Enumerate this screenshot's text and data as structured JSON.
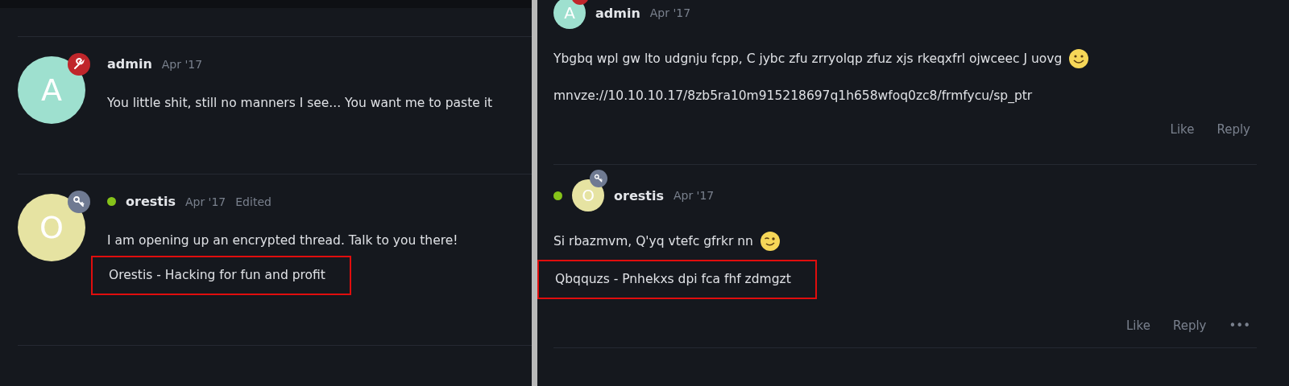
{
  "panels": [
    {
      "compact": false,
      "posts": [
        {
          "author": "admin",
          "date": "Apr '17",
          "avatar_letter": "A",
          "color": "#9ee0cf",
          "badge": {
            "kind": "wrench"
          },
          "online": false,
          "paragraphs": [
            {
              "text": "You little shit, still no manners I see... You want me to paste it"
            }
          ]
        },
        {
          "author": "orestis",
          "date": "Apr '17",
          "edited": "Edited",
          "avatar_letter": "O",
          "color": "#e6e3a2",
          "badge": {
            "kind": "key"
          },
          "online": true,
          "paragraphs": [
            {
              "text": "I am opening up an encrypted thread. Talk to you there!"
            }
          ],
          "signature": {
            "text": "Orestis - Hacking for fun and profit",
            "highlighted": true
          }
        }
      ]
    },
    {
      "compact": true,
      "posts": [
        {
          "author": "admin",
          "date": "Apr '17",
          "avatar_letter": "A",
          "color": "#9ee0cf",
          "badge": {
            "kind": "wrench"
          },
          "online": false,
          "paragraphs": [
            {
              "text": "Ybgbq wpl gw lto udgnju fcpp, C jybc zfu zrryolqp zfuz xjs rkeqxfrl ojwceec J uovg",
              "emoji": {
                "kind": "smile"
              }
            },
            {
              "text": "mnvze://10.10.10.17/8zb5ra10m915218697q1h658wfoq0zc8/frmfycu/sp_ptr"
            }
          ],
          "actions": [
            "Like",
            "Reply"
          ]
        },
        {
          "author": "orestis",
          "date": "Apr '17",
          "avatar_letter": "O",
          "color": "#e6e3a2",
          "badge": {
            "kind": "key"
          },
          "online": true,
          "paragraphs": [
            {
              "text": "Si rbazmvm, Q'yq vtefc gfrkr nn",
              "emoji": {
                "kind": "wink"
              }
            }
          ],
          "signature": {
            "text": "Qbqquzs - Pnhekxs dpi fca fhf zdmgzt",
            "highlighted": true
          },
          "actions": [
            "Like",
            "Reply",
            "•••"
          ]
        }
      ]
    }
  ]
}
